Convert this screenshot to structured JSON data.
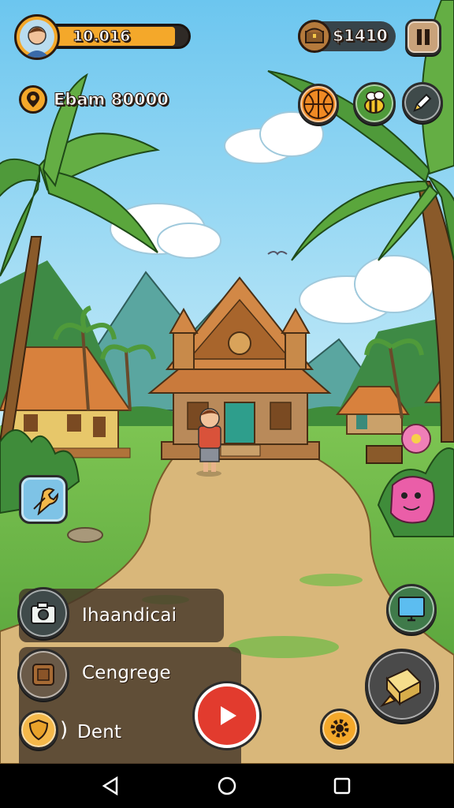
{
  "hud": {
    "player_score": "10.016",
    "location_name": "Ebam 80000",
    "coins": "1410",
    "coin_prefix": "$"
  },
  "menu": {
    "items": [
      {
        "label": "Ihaandicai",
        "icon": "camera-icon"
      },
      {
        "label": "Cengrege",
        "icon": "crate-icon"
      },
      {
        "label": "Dent",
        "icon": "shield-icon"
      }
    ]
  },
  "icons": {
    "left_tool": "wrench-icon",
    "right_top": "monitor-icon",
    "right_bottom": "cheese-wedge-icon",
    "settings": "gear-icon",
    "play": "play-icon",
    "pause": "pause-icon",
    "basketball": "basketball-icon",
    "bee": "bee-icon",
    "pencil": "pencil-icon",
    "treasure": "treasure-chest-icon"
  },
  "colors": {
    "sky": "#8fd3f2",
    "grass": "#6cb94a",
    "path": "#d9b77a",
    "score_bar": "#f4a82a",
    "accent_red": "#e23b2e"
  }
}
